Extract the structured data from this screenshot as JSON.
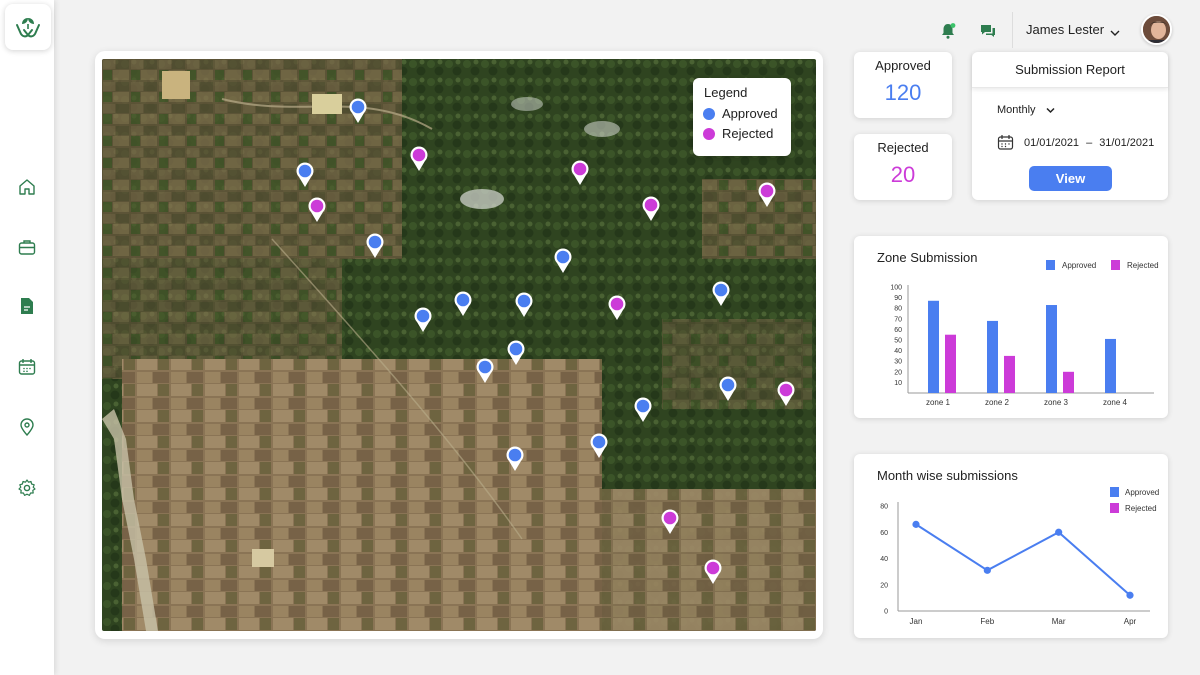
{
  "user": {
    "name": "James Lester"
  },
  "legend": {
    "title": "Legend",
    "approved": "Approved",
    "rejected": "Rejected"
  },
  "colors": {
    "approved": "#4a7ef0",
    "rejected": "#cc3bd8",
    "brand_green": "#2e7d4f"
  },
  "stats": {
    "approved_label": "Approved",
    "approved_value": "120",
    "rejected_label": "Rejected",
    "rejected_value": "20"
  },
  "report": {
    "title": "Submission Report",
    "frequency": "Monthly",
    "date_from": "01/01/2021",
    "date_sep": "–",
    "date_to": "31/01/2021",
    "view_label": "View"
  },
  "nav": {
    "items": [
      {
        "name": "home-icon"
      },
      {
        "name": "briefcase-icon"
      },
      {
        "name": "document-icon",
        "active": true
      },
      {
        "name": "calendar-icon"
      },
      {
        "name": "location-icon"
      },
      {
        "name": "settings-icon"
      }
    ]
  },
  "chart_data": [
    {
      "type": "bar",
      "title": "Zone Submission",
      "categories": [
        "zone 1",
        "zone 2",
        "zone 3",
        "zone 4"
      ],
      "series": [
        {
          "name": "Approved",
          "values": [
            87,
            68,
            83,
            51
          ]
        },
        {
          "name": "Rejected",
          "values": [
            55,
            35,
            20,
            null
          ]
        }
      ],
      "ylim": [
        0,
        100
      ],
      "yticks": [
        10,
        20,
        30,
        40,
        50,
        60,
        70,
        80,
        90,
        100
      ],
      "legend": "top-right"
    },
    {
      "type": "line",
      "title": "Month wise submissions",
      "x": [
        "Jan",
        "Feb",
        "Mar",
        "Apr"
      ],
      "series": [
        {
          "name": "Approved",
          "values": [
            66,
            31,
            60,
            12
          ]
        }
      ],
      "legend_entries": [
        "Approved",
        "Rejected"
      ],
      "ylim": [
        0,
        80
      ],
      "yticks": [
        0,
        20,
        40,
        60,
        80
      ],
      "legend": "top-right"
    }
  ]
}
